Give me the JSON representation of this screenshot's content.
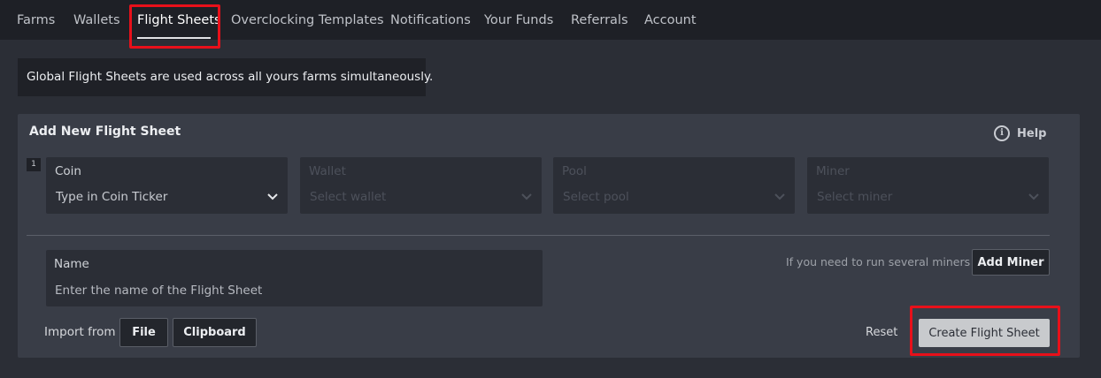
{
  "nav": {
    "items": [
      {
        "label": "Farms"
      },
      {
        "label": "Wallets"
      },
      {
        "label": "Flight Sheets"
      },
      {
        "label": "Overclocking Templates"
      },
      {
        "label": "Notifications"
      },
      {
        "label": "Your Funds"
      },
      {
        "label": "Referrals"
      },
      {
        "label": "Account"
      }
    ],
    "active_index": 2
  },
  "info_text": "Global Flight Sheets are used across all yours farms simultaneously.",
  "panel": {
    "title": "Add New Flight Sheet",
    "help_label": "Help",
    "row_number": "1",
    "selects": [
      {
        "label": "Coin",
        "value": "Type in Coin Ticker",
        "enabled": true
      },
      {
        "label": "Wallet",
        "value": "Select wallet",
        "enabled": false
      },
      {
        "label": "Pool",
        "value": "Select pool",
        "enabled": false
      },
      {
        "label": "Miner",
        "value": "Select miner",
        "enabled": false
      }
    ],
    "name_label": "Name",
    "name_placeholder": "Enter the name of the Flight Sheet",
    "name_value": "",
    "several_miners_hint": "If you need to run several miners",
    "add_miner_label": "Add Miner",
    "import_label": "Import from",
    "import_file_label": "File",
    "import_clipboard_label": "Clipboard",
    "reset_label": "Reset",
    "create_label": "Create Flight Sheet"
  },
  "colors": {
    "highlight": "#e8101a",
    "page_bg": "#2b2e36",
    "panel_bg": "#393d47",
    "nav_bg": "#1e2026"
  }
}
